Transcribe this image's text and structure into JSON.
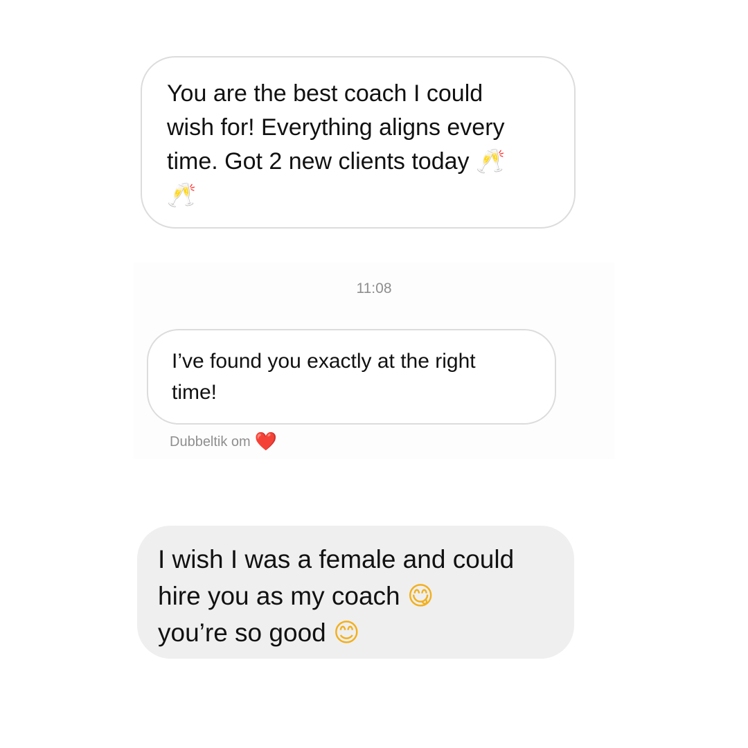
{
  "messages": [
    {
      "text": "You are the best coach I could\nwish for! Everything aligns every\ntime. Got 2 new clients today ",
      "emoji_inline": "🥂",
      "emoji_next_line": "🥂"
    },
    {
      "timestamp": "11:08",
      "text": "I’ve found you exactly at the right\ntime!",
      "hint_label": "Dubbeltik om",
      "hint_emoji": "❤️"
    },
    {
      "text_line1": "I wish I was a female and could",
      "text_line2": "hire you as my coach ",
      "emoji_line2": "😋",
      "text_line3": "you’re so good ",
      "emoji_line3": "😊"
    }
  ],
  "colors": {
    "bubble_outline": "#dcdcdc",
    "bubble_filled": "#efefef",
    "meta_text": "#8e8e8e",
    "heart": "#e0245e"
  },
  "icons": [
    "champagne-glasses-icon",
    "heart-icon",
    "yum-face-icon",
    "smiling-face-icon"
  ]
}
